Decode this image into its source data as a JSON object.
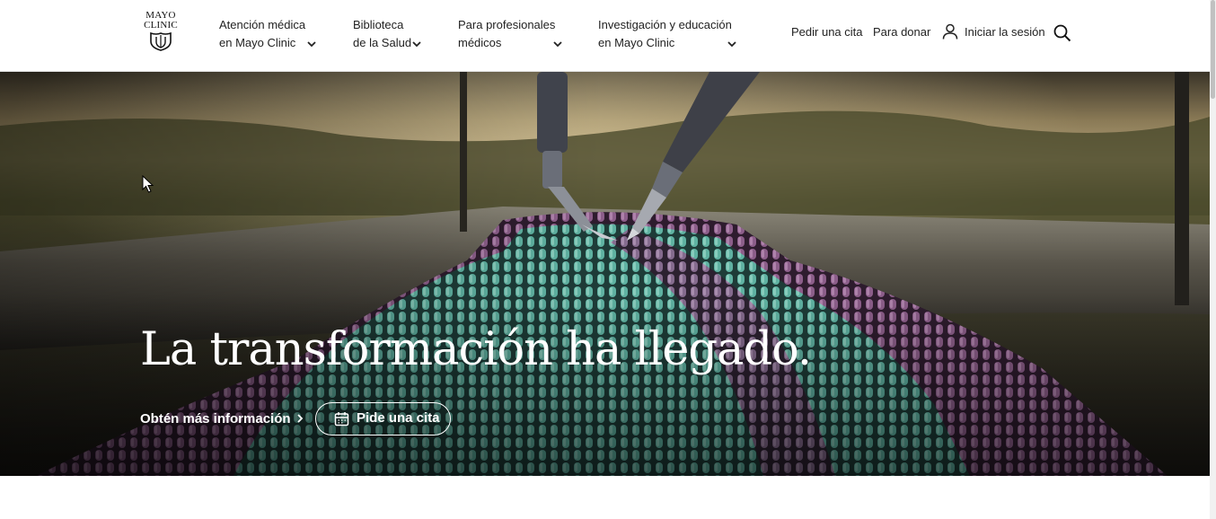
{
  "header": {
    "logo": {
      "line1": "MAYO",
      "line2": "CLINIC"
    },
    "nav": [
      {
        "line1": "Atención médica",
        "line2": "en Mayo Clinic",
        "icon": "chevron-down-icon"
      },
      {
        "line1": "Biblioteca",
        "line2": "de la Salud",
        "icon": "chevron-down-icon"
      },
      {
        "line1": "Para profesionales",
        "line2": "médicos",
        "icon": "chevron-down-icon"
      },
      {
        "line1": "Investigación y educación",
        "line2": "en Mayo Clinic",
        "icon": "chevron-down-icon"
      }
    ],
    "utility": {
      "appointment": "Pedir una cita",
      "donate": "Para donar",
      "sign_in": "Iniciar la sesión",
      "sign_in_icon": "user-icon",
      "search_icon": "search-icon"
    }
  },
  "hero": {
    "title": "La transformación ha llegado.",
    "learn_more": "Obtén más información",
    "appointment_button": "Pide una cita",
    "appointment_icon": "calendar-icon"
  },
  "colors": {
    "header_bg": "#ffffff",
    "text_dark": "#222222",
    "hero_text": "#ffffff"
  }
}
